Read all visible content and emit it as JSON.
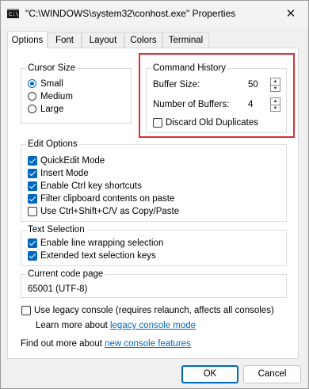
{
  "window": {
    "title": "\"C:\\WINDOWS\\system32\\conhost.exe\" Properties",
    "icon_text": "C:\\",
    "close_glyph": "✕"
  },
  "tabs": [
    "Options",
    "Font",
    "Layout",
    "Colors",
    "Terminal"
  ],
  "active_tab": "Options",
  "cursor_size": {
    "title": "Cursor Size",
    "options": [
      "Small",
      "Medium",
      "Large"
    ],
    "selected": "Small"
  },
  "command_history": {
    "title": "Command History",
    "buffer_size_label": "Buffer Size:",
    "buffer_size_value": "50",
    "num_buffers_label": "Number of Buffers:",
    "num_buffers_value": "4",
    "discard_label": "Discard Old Duplicates",
    "discard_checked": false
  },
  "edit_options": {
    "title": "Edit Options",
    "items": [
      {
        "label": "QuickEdit Mode",
        "checked": true
      },
      {
        "label": "Insert Mode",
        "checked": true
      },
      {
        "label": "Enable Ctrl key shortcuts",
        "checked": true
      },
      {
        "label": "Filter clipboard contents on paste",
        "checked": true
      },
      {
        "label": "Use Ctrl+Shift+C/V as Copy/Paste",
        "checked": false
      }
    ]
  },
  "text_selection": {
    "title": "Text Selection",
    "items": [
      {
        "label": "Enable line wrapping selection",
        "checked": true
      },
      {
        "label": "Extended text selection keys",
        "checked": true
      }
    ]
  },
  "code_page": {
    "title": "Current code page",
    "value": "65001 (UTF-8)"
  },
  "legacy": {
    "label": "Use legacy console (requires relaunch, affects all consoles)",
    "checked": false,
    "learn_prefix": "Learn more about ",
    "learn_link": "legacy console mode"
  },
  "footer": {
    "prefix": "Find out more about ",
    "link": "new console features"
  },
  "buttons": {
    "ok": "OK",
    "cancel": "Cancel"
  },
  "colors": {
    "accent": "#0067c0",
    "highlight": "#d9303a"
  }
}
